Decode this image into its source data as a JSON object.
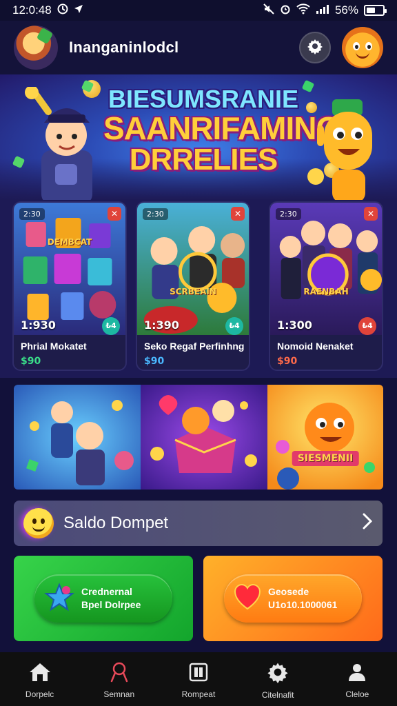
{
  "status_bar": {
    "time": "12:0:48",
    "battery_text": "56%",
    "battery_level": 0.56
  },
  "header": {
    "title": "Inanganinlodcl"
  },
  "hero": {
    "line1": "BIESUMSRANIE",
    "line2": "SAANRIFAMING",
    "line3": "DRRELIES"
  },
  "game_cards": [
    {
      "tag": "2:30",
      "players": "1:930",
      "badge": "₺4",
      "badge_color": "#1db8a2",
      "name": "Phrial Mokatet",
      "price": "$90",
      "price_color": "#3adf8a",
      "mid_label": "DEMBCAT"
    },
    {
      "tag": "2:30",
      "players": "1:390",
      "badge": "₺4",
      "badge_color": "#1db8a2",
      "name": "Seko Regaf Perfinhng",
      "price": "$90",
      "price_color": "#4ab8ff",
      "mid_label": "SCRBEAIN"
    },
    {
      "tag": "2:30",
      "players": "1:300",
      "badge": "₺4",
      "badge_color": "#e0443a",
      "name": "Nomoid Nenaket",
      "price": "$90",
      "price_color": "#ff6a4a",
      "mid_label": "RAENBAH"
    }
  ],
  "promo": {
    "tile3_label": "SIESMENII"
  },
  "wallet": {
    "label": "Saldo Dompet"
  },
  "actions": {
    "left_line1": "Crednernal",
    "left_line2": "Bpel Dolrpee",
    "right_line1": "Geosede",
    "right_line2": "U1o10.1000061"
  },
  "nav": [
    {
      "label": "Dorpelc"
    },
    {
      "label": "Semnan"
    },
    {
      "label": "Rompeat"
    },
    {
      "label": "Citelnafit"
    },
    {
      "label": "Cleloe"
    }
  ]
}
